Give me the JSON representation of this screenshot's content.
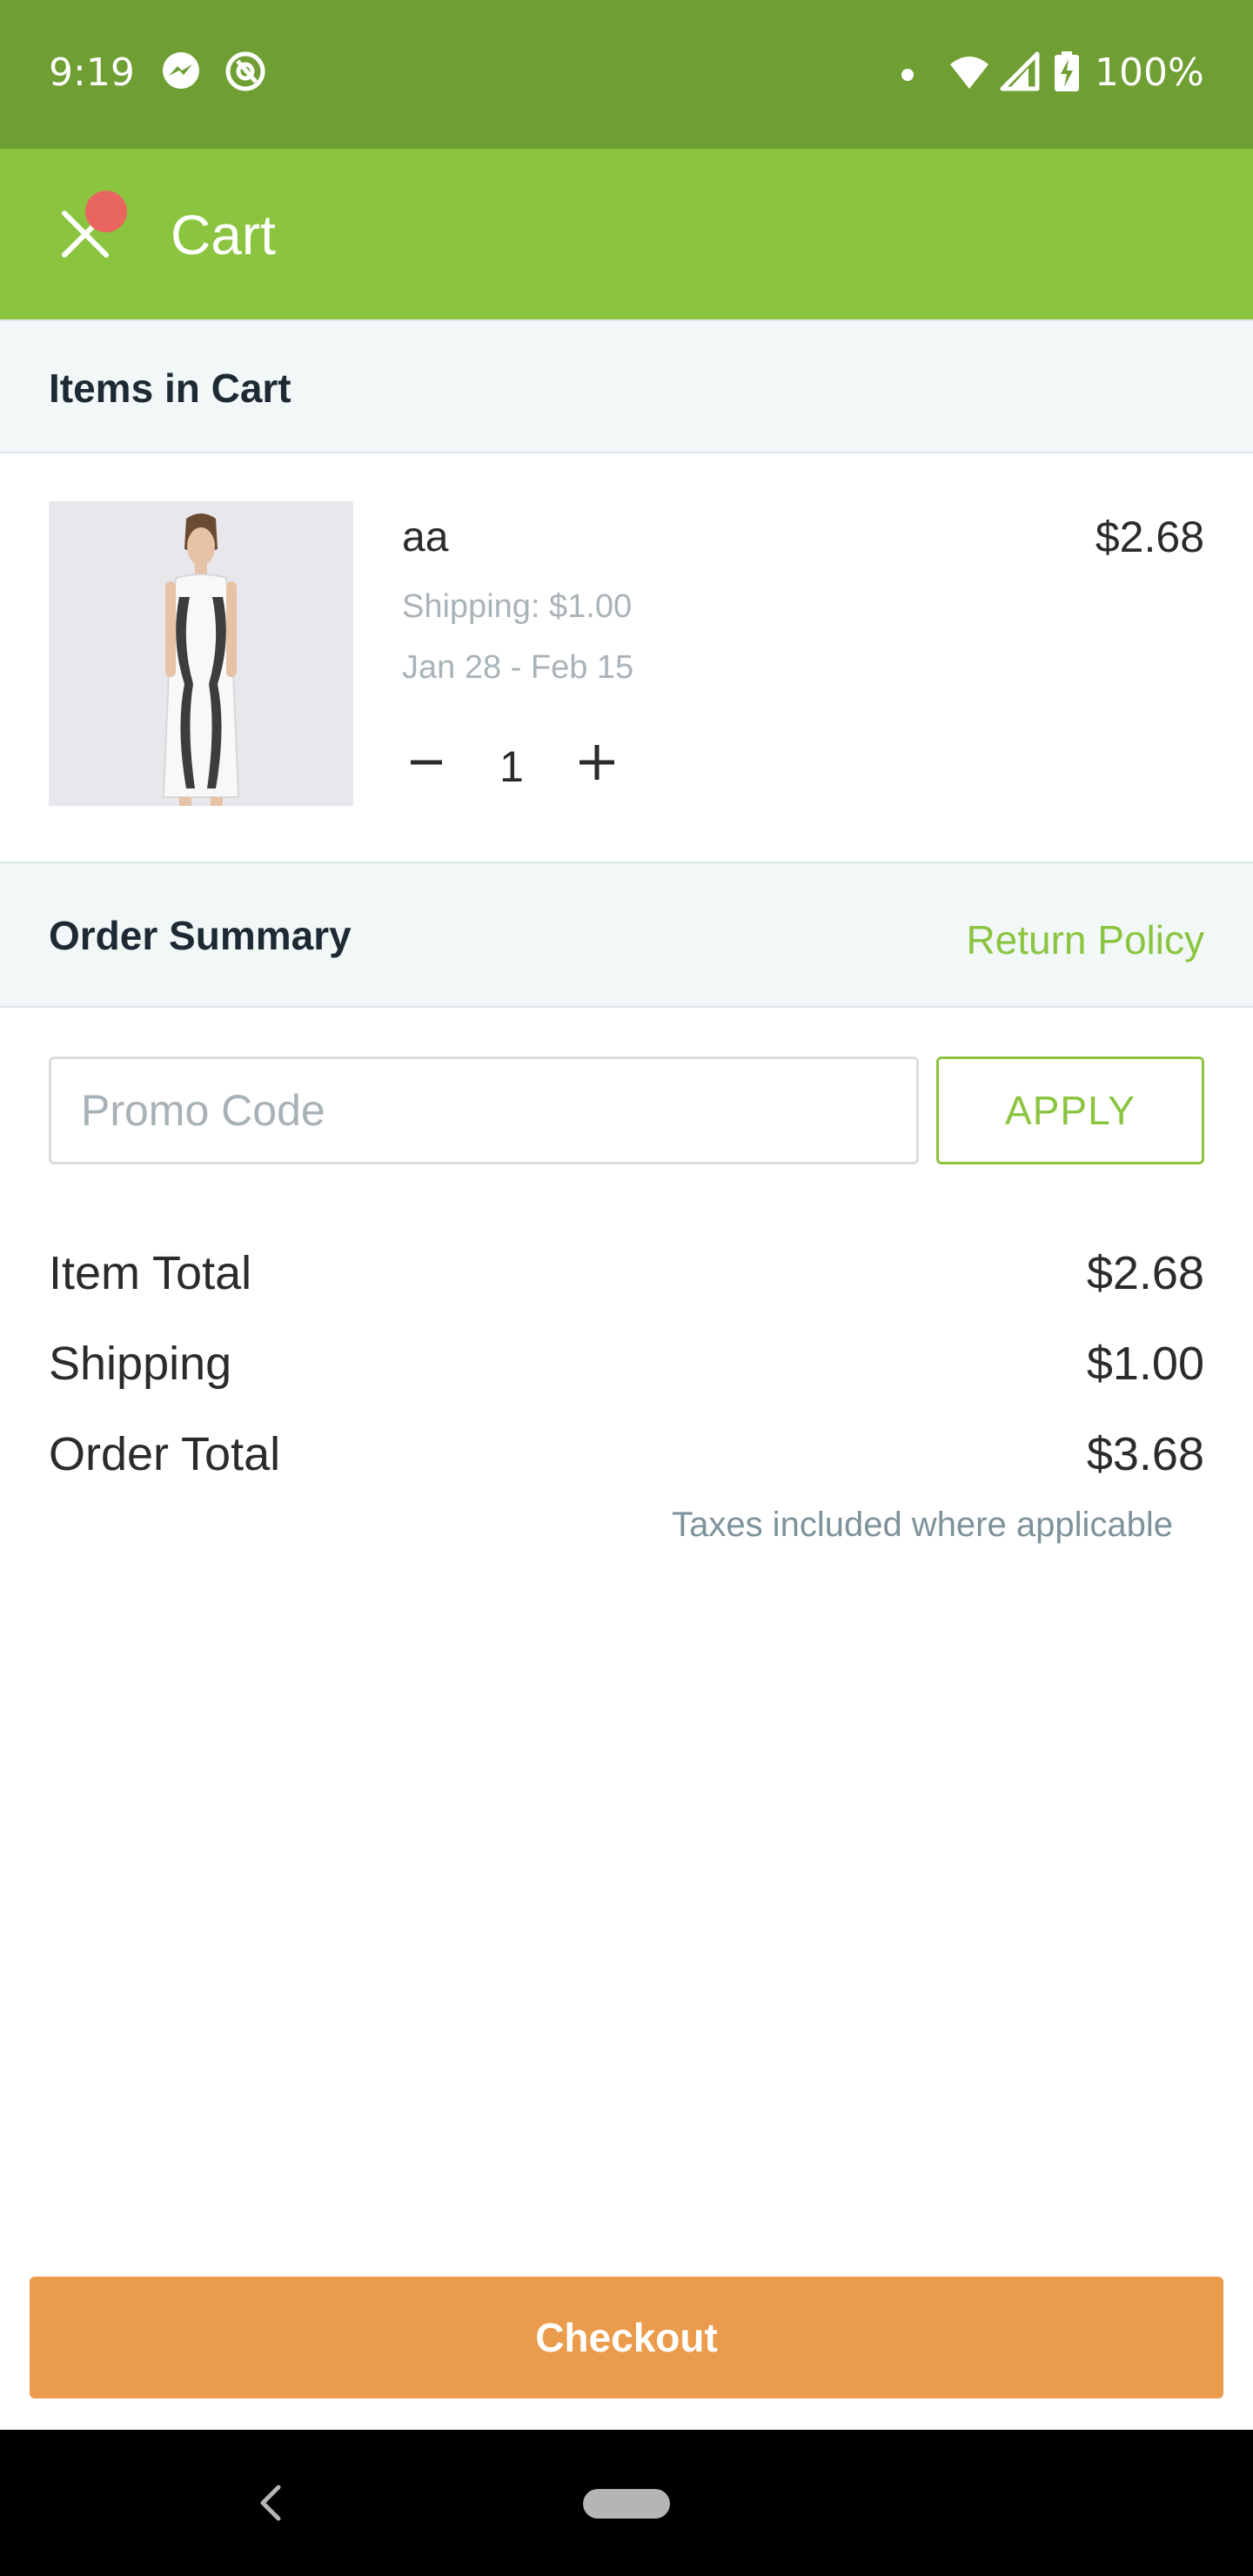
{
  "status_bar": {
    "time": "9:19",
    "battery": "100%",
    "icons": [
      "messenger-icon",
      "at-sign-icon",
      "wifi-icon",
      "signal-icon",
      "battery-charging-icon"
    ]
  },
  "app_bar": {
    "title": "Cart",
    "close_icon": "close-icon",
    "background": "#8bc540"
  },
  "cart": {
    "section_title": "Items in Cart",
    "items": [
      {
        "name": "aa",
        "price": "$2.68",
        "shipping": "Shipping: $1.00",
        "delivery": "Jan 28 - Feb 15",
        "quantity": "1"
      }
    ]
  },
  "order_summary": {
    "section_title": "Order Summary",
    "return_policy": "Return Policy",
    "promo_placeholder": "Promo Code",
    "apply_label": "APPLY",
    "rows": [
      {
        "label": "Item Total",
        "value": "$2.68"
      },
      {
        "label": "Shipping",
        "value": "$1.00"
      },
      {
        "label": "Order Total",
        "value": "$3.68"
      }
    ],
    "taxes_note": "Taxes included where applicable"
  },
  "checkout": {
    "label": "Checkout",
    "color": "#eb9b4c"
  },
  "nav_bar": {
    "icons": [
      "back-icon",
      "home-pill-icon"
    ]
  }
}
